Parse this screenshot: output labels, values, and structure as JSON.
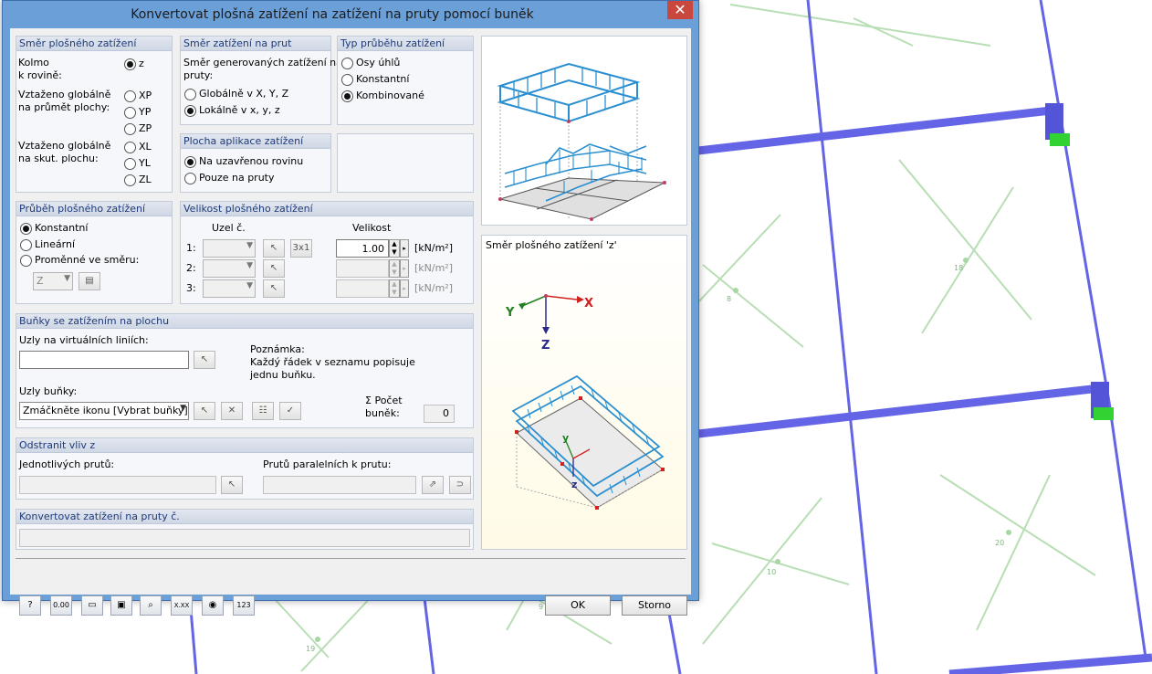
{
  "dialog": {
    "title": "Konvertovat plošná zatížení na zatížení na pruty pomocí buněk",
    "close_glyph": "✕"
  },
  "g_dir": {
    "title": "Směr plošného zatížení",
    "perp": "Kolmo\nk rovině:",
    "z": "z",
    "proj": "Vztaženo globálně\nna průmět plochy:",
    "xp": "XP",
    "yp": "YP",
    "zp": "ZP",
    "true": "Vztaženo globálně\nna skut. plochu:",
    "xl": "XL",
    "yl": "YL",
    "zl": "ZL"
  },
  "g_mdir": {
    "title": "Směr zatížení na prut",
    "desc": "Směr generovaných zatížení na\npruty:",
    "glob": "Globálně v X, Y, Z",
    "loc": "Lokálně v x, y, z"
  },
  "g_type": {
    "title": "Typ průběhu zatížení",
    "o1": "Osy úhlů",
    "o2": "Konstantní",
    "o3": "Kombinované"
  },
  "g_app": {
    "title": "Plocha aplikace zatížení",
    "o1": "Na uzavřenou rovinu",
    "o2": "Pouze na pruty"
  },
  "g_dist": {
    "title": "Průběh plošného zatížení",
    "o1": "Konstantní",
    "o2": "Lineární",
    "o3": "Proměnné ve směru:",
    "combo": "Z"
  },
  "g_mag": {
    "title": "Velikost plošného zatížení",
    "h_node": "Uzel č.",
    "h_val": "Velikost",
    "r1": "1:",
    "r2": "2:",
    "r3": "3:",
    "v1": "1.00",
    "unit": "[kN/m²]",
    "btn3": "3x1"
  },
  "g_cells": {
    "title": "Buňky se zatížením na plochu",
    "vnodes": "Uzly na virtuálních liniích:",
    "note": "Poznámka:\nKaždý řádek v seznamu popisuje\njednu buňku.",
    "cnodes": "Uzly buňky:",
    "combo": "Zmáčkněte ikonu [Vybrat buňky]",
    "count_lbl": "Σ Počet\nbuněk:",
    "count": "0"
  },
  "g_rem": {
    "title": "Odstranit vliv z",
    "single": "Jednotlivých prutů:",
    "parallel": "Prutů paralelních k prutu:"
  },
  "g_conv": {
    "title": "Konvertovat zatížení na pruty č."
  },
  "preview": {
    "title": "Směr plošného zatížení 'z'",
    "X": "X",
    "Y": "Y",
    "Z": "Z",
    "y": "y",
    "z": "z"
  },
  "footer": {
    "ok": "OK",
    "cancel": "Storno",
    "t2": "0.00",
    "t7": "X.XX"
  },
  "bg_labels": {
    "n8": "8",
    "n18": "18",
    "n10": "10",
    "n20": "20",
    "n9": "9",
    "n19": "19"
  },
  "colors": {
    "frame": "#6b9fd8",
    "beam": "#6464e6",
    "gridline": "#b8deb4",
    "load": "#2a8fd0",
    "support": "#32d232"
  }
}
